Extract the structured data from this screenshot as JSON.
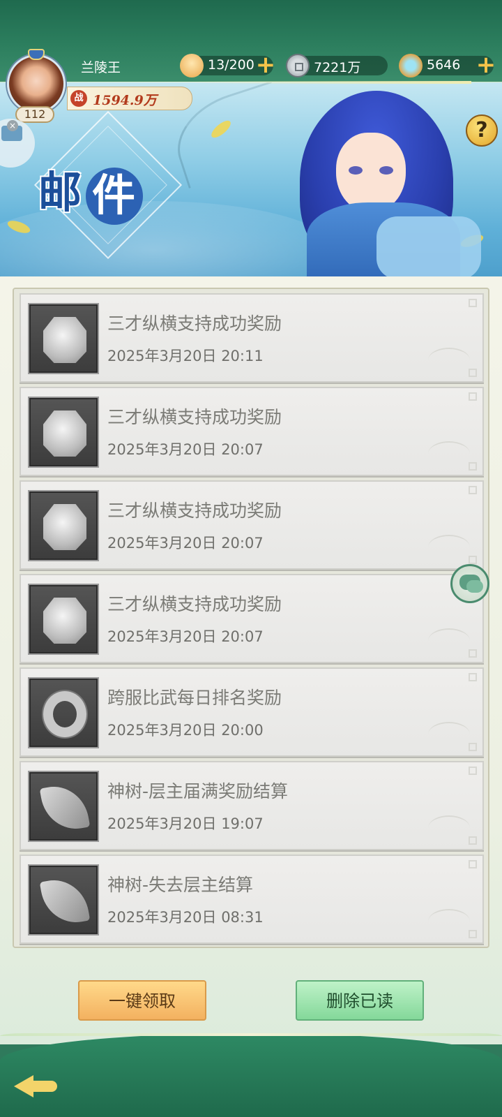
{
  "header": {
    "player_name": "兰陵王",
    "level": "112",
    "power_icon_char": "战",
    "power_value": "1594.9万",
    "resources": [
      {
        "name": "steamed-bun",
        "value": "13/200",
        "has_plus": true
      },
      {
        "name": "copper-coin",
        "value": "7221万",
        "has_plus": false
      },
      {
        "name": "jade",
        "value": "5646",
        "has_plus": true
      }
    ],
    "plus_glyph": "+",
    "help_glyph": "?",
    "close_glyph": "×"
  },
  "banner": {
    "title_first": "邮",
    "title_second": "件"
  },
  "mails": [
    {
      "title": "三才纵横支持成功奖励",
      "time": "2025年3月20日 20:11",
      "icon": "stone-icon"
    },
    {
      "title": "三才纵横支持成功奖励",
      "time": "2025年3月20日 20:07",
      "icon": "stone-icon"
    },
    {
      "title": "三才纵横支持成功奖励",
      "time": "2025年3月20日 20:07",
      "icon": "stone-icon"
    },
    {
      "title": "三才纵横支持成功奖励",
      "time": "2025年3月20日 20:07",
      "icon": "stone-icon"
    },
    {
      "title": "跨服比武每日排名奖励",
      "time": "2025年3月20日 20:00",
      "icon": "dragon-ring-icon"
    },
    {
      "title": "神树-层主届满奖励结算",
      "time": "2025年3月20日 19:07",
      "icon": "leaf-icon"
    },
    {
      "title": "神树-失去层主结算",
      "time": "2025年3月20日 08:31",
      "icon": "leaf-icon"
    }
  ],
  "actions": {
    "claim_all": "一键领取",
    "delete_read": "删除已读"
  }
}
